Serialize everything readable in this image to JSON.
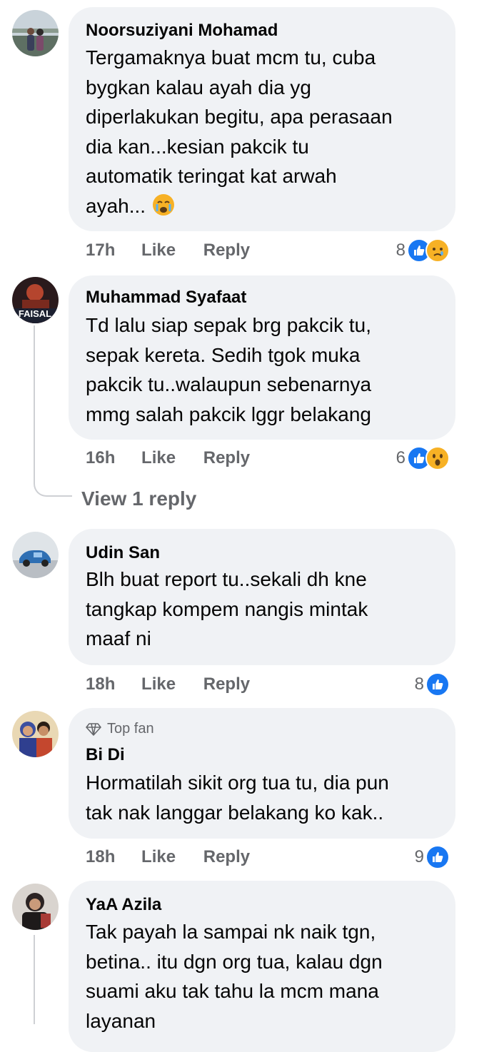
{
  "comments": [
    {
      "name": "Noorsuziyani Mohamad",
      "text": "Tergamaknya buat mcm tu, cuba\nbygkan kalau ayah dia yg\ndiperlakukan begitu, apa perasaan\ndia kan...kesian pakcik tu\nautomatik teringat kat arwah\nayah...",
      "trailing_emoji": "crying-face",
      "time": "17h",
      "like_label": "Like",
      "reply_label": "Reply",
      "reaction_count": "8",
      "reactions": [
        "like-icon",
        "sad-icon"
      ]
    },
    {
      "name": "Muhammad Syafaat",
      "avatar_text": "FAISAL",
      "text": "Td lalu siap sepak brg pakcik tu,\nsepak kereta. Sedih tgok muka\npakcik tu..walaupun sebenarnya\nmmg salah pakcik lggr belakang",
      "time": "16h",
      "like_label": "Like",
      "reply_label": "Reply",
      "reaction_count": "6",
      "reactions": [
        "like-icon",
        "wow-icon"
      ],
      "view_replies": "View 1 reply"
    },
    {
      "name": "Udin San",
      "text": "Blh buat report tu..sekali dh kne\ntangkap kompem nangis mintak\nmaaf ni",
      "time": "18h",
      "like_label": "Like",
      "reply_label": "Reply",
      "reaction_count": "8",
      "reactions": [
        "like-icon"
      ]
    },
    {
      "badge": "Top fan",
      "name": "Bi Di",
      "text": "Hormatilah sikit org tua tu, dia pun\ntak nak langgar belakang ko kak..",
      "time": "18h",
      "like_label": "Like",
      "reply_label": "Reply",
      "reaction_count": "9",
      "reactions": [
        "like-icon"
      ]
    },
    {
      "name": "YaA Azila",
      "text": "Tak payah la sampai nk naik tgn,\nbetina.. itu dgn org tua, kalau dgn\nsuami aku tak tahu la mcm mana\nlayanan"
    }
  ],
  "colors": {
    "bubble": "#f0f2f5",
    "secondary_text": "#65676b",
    "like_blue": "#1877f2",
    "emoji_yellow": "#f7b125"
  }
}
